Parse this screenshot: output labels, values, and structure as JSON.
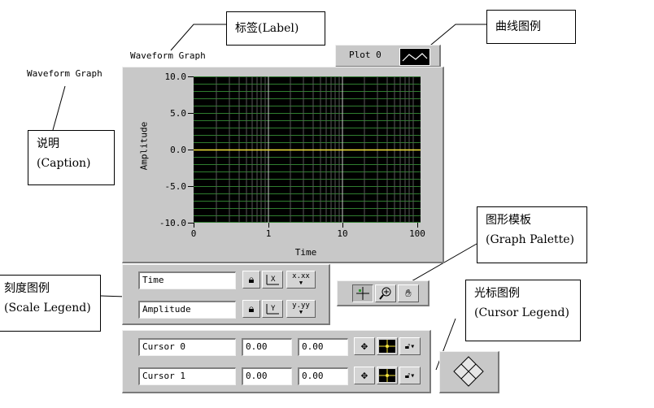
{
  "graph": {
    "label": "Waveform Graph",
    "caption": "Waveform Graph",
    "plot_legend": {
      "name": "Plot 0"
    },
    "colors": {
      "plot_bg": "#000000",
      "grid": "#2f7d2f",
      "trace": "#f4e33a",
      "panel": "#c8c8c8"
    },
    "y_ticks": [
      "10.0",
      "5.0",
      "0.0",
      "-5.0",
      "-10.0"
    ],
    "x_ticks": [
      "0",
      "1",
      "10",
      "100"
    ],
    "x_axis_label": "Time",
    "y_axis_label": "Amplitude"
  },
  "scale_legend": {
    "rows": [
      {
        "name": "Time",
        "format_label": "x.xx"
      },
      {
        "name": "Amplitude",
        "format_label": "y.yy"
      }
    ]
  },
  "cursor_legend": {
    "rows": [
      {
        "name": "Cursor 0",
        "x": "0.00",
        "y": "0.00"
      },
      {
        "name": "Cursor 1",
        "x": "0.00",
        "y": "0.00"
      }
    ]
  },
  "callouts": {
    "label": "标签(Label)",
    "plot_legend": "曲线图例",
    "caption_line1": "说明",
    "caption_line2": "(Caption)",
    "graph_palette_line1": "图形模板",
    "graph_palette_line2": "(Graph Palette)",
    "scale_legend_line1": "刻度图例",
    "scale_legend_line2": "(Scale Legend)",
    "cursor_legend_line1": "光标图例",
    "cursor_legend_line2": "(Cursor Legend)"
  }
}
